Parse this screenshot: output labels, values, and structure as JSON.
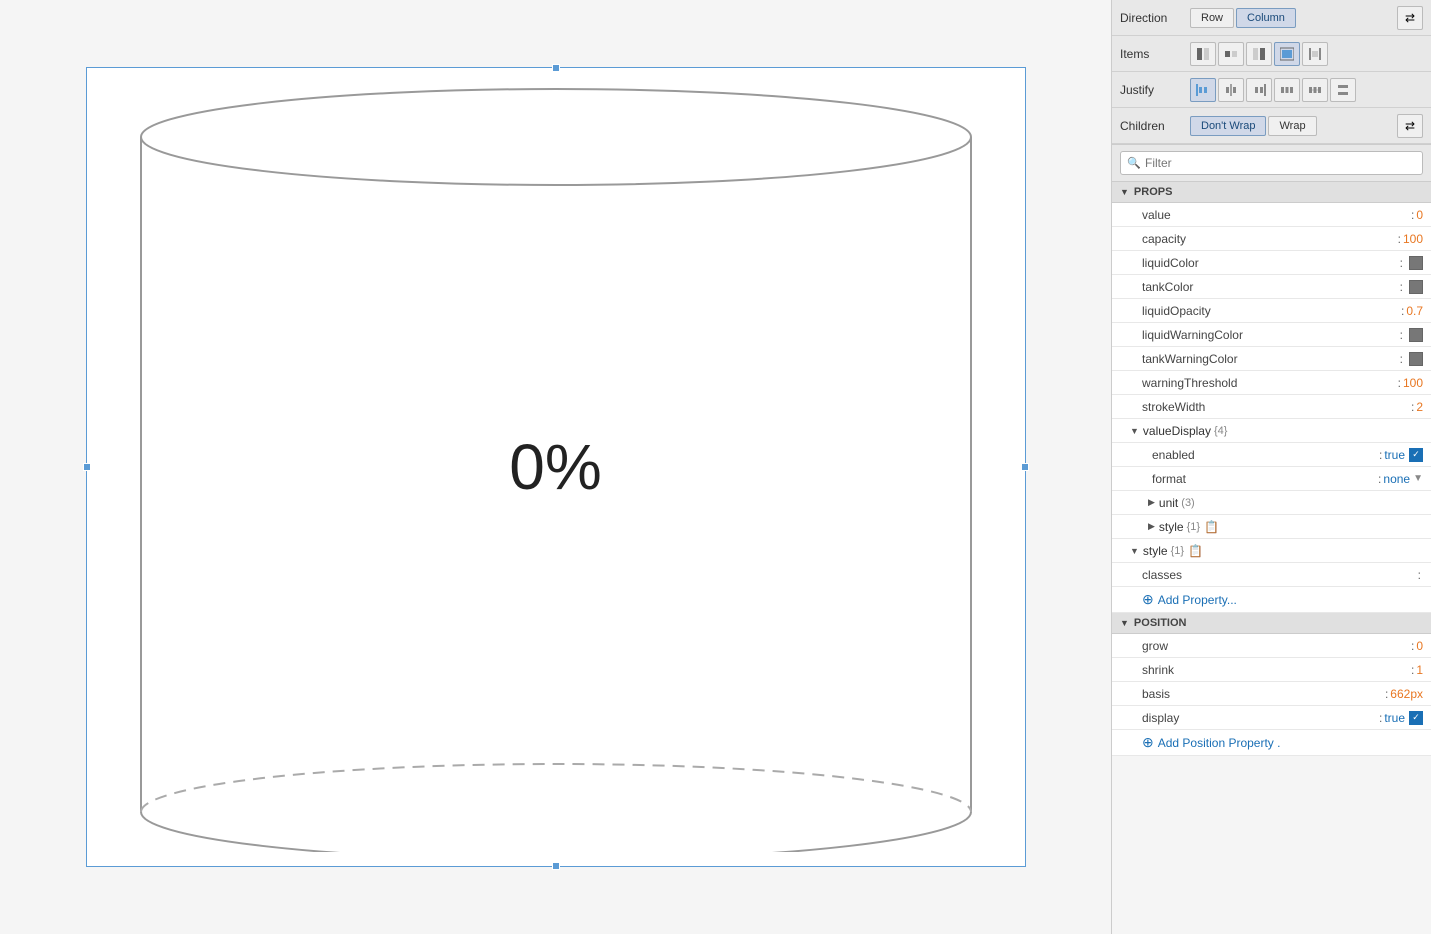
{
  "canvas": {
    "tank_label": "0%"
  },
  "flex_controls": {
    "direction_label": "Direction",
    "items_label": "Items",
    "justify_label": "Justify",
    "children_label": "Children",
    "direction_row": "Row",
    "direction_column": "Column",
    "children_no_wrap": "Don't Wrap",
    "children_wrap": "Wrap"
  },
  "filter": {
    "placeholder": "Filter"
  },
  "props_section": {
    "title": "PROPS",
    "properties": [
      {
        "name": "value",
        "separator": ":",
        "value": "0",
        "type": "orange"
      },
      {
        "name": "capacity",
        "separator": ":",
        "value": "100",
        "type": "orange"
      },
      {
        "name": "liquidColor",
        "separator": ":",
        "value": "",
        "type": "swatch"
      },
      {
        "name": "tankColor",
        "separator": ":",
        "value": "",
        "type": "swatch"
      },
      {
        "name": "liquidOpacity",
        "separator": ":",
        "value": "0.7",
        "type": "orange"
      },
      {
        "name": "liquidWarningColor",
        "separator": ":",
        "value": "",
        "type": "swatch"
      },
      {
        "name": "tankWarningColor",
        "separator": ":",
        "value": "",
        "type": "swatch"
      },
      {
        "name": "warningThreshold",
        "separator": ":",
        "value": "100",
        "type": "orange"
      },
      {
        "name": "strokeWidth",
        "separator": ":",
        "value": "2",
        "type": "orange"
      }
    ],
    "value_display": {
      "name": "valueDisplay",
      "count": "{4}",
      "children": [
        {
          "name": "enabled",
          "separator": ":",
          "value": "true",
          "type": "blue-check"
        },
        {
          "name": "format",
          "separator": ":",
          "value": "none",
          "type": "blue-dropdown"
        }
      ],
      "sub_groups": [
        {
          "name": "unit",
          "count": "(3)",
          "expanded": false
        },
        {
          "name": "style",
          "count": "{1}",
          "expanded": false,
          "has_icon": true
        }
      ]
    },
    "style_group": {
      "name": "style",
      "count": "{1}",
      "has_icon": true,
      "children": [
        {
          "name": "classes",
          "separator": ":",
          "value": "",
          "type": "text"
        }
      ]
    },
    "add_property_label": "Add Property..."
  },
  "position_section": {
    "title": "POSITION",
    "properties": [
      {
        "name": "grow",
        "separator": ":",
        "value": "0",
        "type": "orange"
      },
      {
        "name": "shrink",
        "separator": ":",
        "value": "1",
        "type": "orange"
      },
      {
        "name": "basis",
        "separator": ":",
        "value": "662px",
        "type": "orange"
      },
      {
        "name": "display",
        "separator": ":",
        "value": "true",
        "type": "blue-check"
      }
    ],
    "add_property_label": "Add Position Property ."
  }
}
